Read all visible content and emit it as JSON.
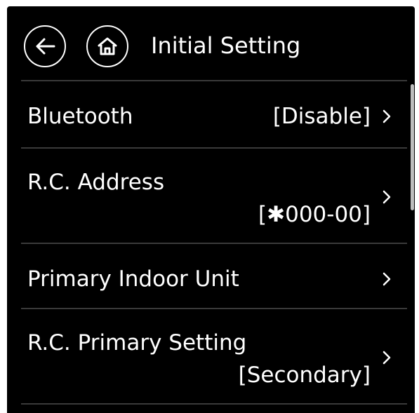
{
  "header": {
    "title": "Initial Setting",
    "back_icon": "arrow-left-icon",
    "home_icon": "home-icon"
  },
  "items": [
    {
      "label": "Bluetooth",
      "value": "[Disable]"
    },
    {
      "label": "R.C. Address",
      "value": "[✱000-00]"
    },
    {
      "label": "Primary Indoor Unit",
      "value": ""
    },
    {
      "label": "R.C. Primary Setting",
      "value": "[Secondary]"
    }
  ],
  "colors": {
    "background": "#000000",
    "text": "#ffffff",
    "divider": "#3a3a3a",
    "scrollbar": "#bdbdbd"
  }
}
